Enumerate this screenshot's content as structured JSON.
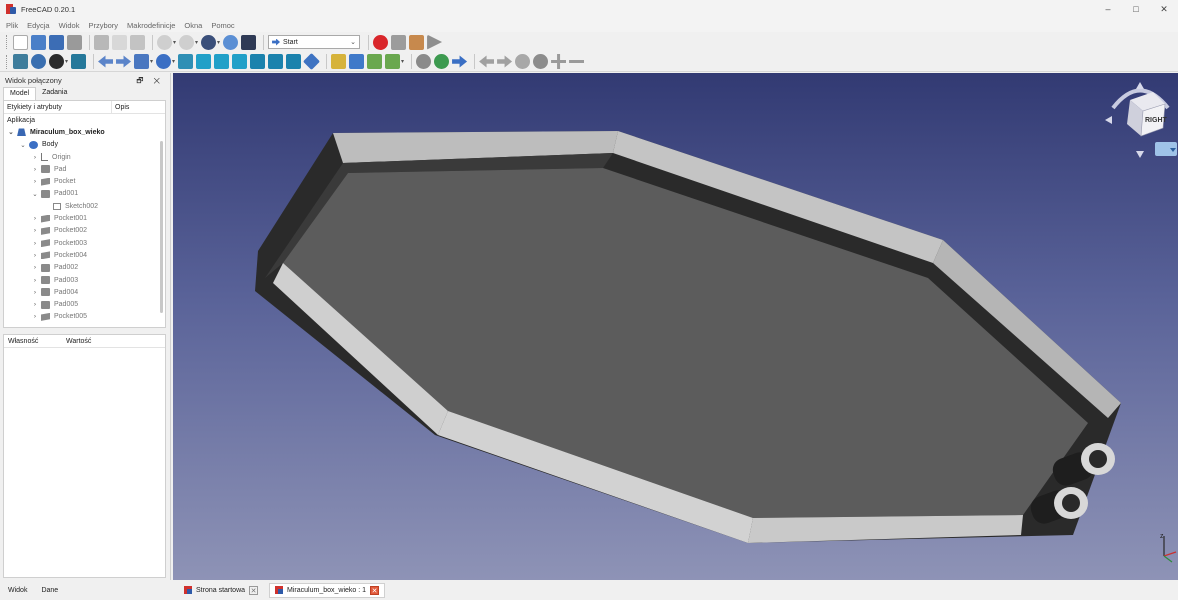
{
  "window": {
    "title": "FreeCAD 0.20.1",
    "minimize": "–",
    "maximize": "□",
    "close": "✕"
  },
  "menu": [
    "Plik",
    "Edycja",
    "Widok",
    "Przybory",
    "Makrodefinicje",
    "Okna",
    "Pomoc"
  ],
  "toolbar": {
    "workbench": "Start"
  },
  "combo_view": {
    "title": "Widok połączony",
    "title_controls": "🗗 ✕",
    "tabs": [
      "Model",
      "Zadania"
    ],
    "tree_headers": [
      "Etykiety i atrybuty",
      "Opis"
    ],
    "section": "Aplikacja",
    "tree": [
      {
        "label": "Miraculum_box_wieko",
        "arrow": "⌄",
        "icon": "doc",
        "indent": 1,
        "bold": true
      },
      {
        "label": "Body",
        "arrow": "⌄",
        "icon": "body",
        "indent": 2
      },
      {
        "label": "Origin",
        "arrow": "›",
        "icon": "origin",
        "indent": 3,
        "gray": true
      },
      {
        "label": "Pad",
        "arrow": "›",
        "icon": "pad",
        "indent": 3,
        "gray": true
      },
      {
        "label": "Pocket",
        "arrow": "›",
        "icon": "pocket",
        "indent": 3,
        "gray": true
      },
      {
        "label": "Pad001",
        "arrow": "⌄",
        "icon": "pad",
        "indent": 3,
        "gray": true
      },
      {
        "label": "Sketch002",
        "arrow": "",
        "icon": "sketch",
        "indent": 4,
        "gray": true
      },
      {
        "label": "Pocket001",
        "arrow": "›",
        "icon": "pocket",
        "indent": 3,
        "gray": true
      },
      {
        "label": "Pocket002",
        "arrow": "›",
        "icon": "pocket",
        "indent": 3,
        "gray": true
      },
      {
        "label": "Pocket003",
        "arrow": "›",
        "icon": "pocket",
        "indent": 3,
        "gray": true
      },
      {
        "label": "Pocket004",
        "arrow": "›",
        "icon": "pocket",
        "indent": 3,
        "gray": true
      },
      {
        "label": "Pad002",
        "arrow": "›",
        "icon": "pad",
        "indent": 3,
        "gray": true
      },
      {
        "label": "Pad003",
        "arrow": "›",
        "icon": "pad",
        "indent": 3,
        "gray": true
      },
      {
        "label": "Pad004",
        "arrow": "›",
        "icon": "pad",
        "indent": 3,
        "gray": true
      },
      {
        "label": "Pad005",
        "arrow": "›",
        "icon": "pad",
        "indent": 3,
        "gray": true
      },
      {
        "label": "Pocket005",
        "arrow": "›",
        "icon": "pocket",
        "indent": 3,
        "gray": true
      }
    ],
    "prop_headers": [
      "Własność",
      "Wartość"
    ],
    "bottom_tabs": [
      "Widok",
      "Dane"
    ]
  },
  "doc_tabs": [
    {
      "label": "Strona startowa",
      "active": false
    },
    {
      "label": "Miraculum_box_wieko : 1",
      "active": true
    }
  ],
  "nav_cube": {
    "face": "RIGHT"
  },
  "axis": {
    "z": "z"
  },
  "colors": {
    "record": "#d9262b",
    "accent": "#3b6fc4",
    "viewport_top": "#323a73",
    "viewport_bottom": "#8e93b6"
  }
}
